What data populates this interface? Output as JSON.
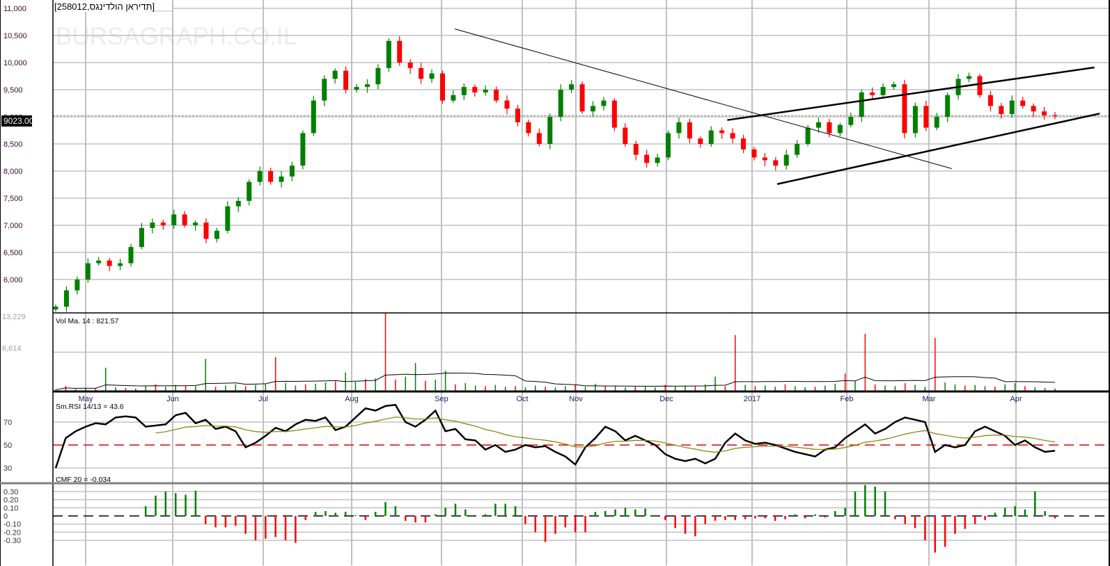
{
  "header": {
    "title": "[258012,תדיראן הולדינגס]",
    "watermark": "BURSAGRAPH.CO.IL",
    "last_price_label": "9023.00"
  },
  "colors": {
    "up": "#008000",
    "down": "#ff0000",
    "grid": "#c0c0c0",
    "signal": "#808000",
    "rsi_mid": "#e00000"
  },
  "chart_data": [
    {
      "type": "candlestick",
      "name": "price",
      "yticks": [
        "11,000",
        "10,500",
        "10,000",
        "9,500",
        "9,000",
        "8,500",
        "8,000",
        "7,500",
        "7,000",
        "6,500",
        "6,000"
      ],
      "ytick_values": [
        11000,
        10500,
        10000,
        9500,
        9000,
        8500,
        8000,
        7500,
        7000,
        6500,
        6000
      ],
      "ylim": [
        5300,
        11150
      ],
      "last_price": 9023,
      "x_months": [
        "May",
        "Jun",
        "Jul",
        "Aug",
        "Sep",
        "Oct",
        "Nov",
        "Dec",
        "2017",
        "Feb",
        "Mar",
        "Apr"
      ],
      "first_open": 5450,
      "close": [
        5500,
        5800,
        6000,
        6300,
        6350,
        6250,
        6300,
        6600,
        6950,
        7050,
        7000,
        7200,
        7000,
        7050,
        6750,
        6900,
        7350,
        7450,
        7800,
        8000,
        7800,
        7900,
        8100,
        8700,
        9300,
        9700,
        9850,
        9500,
        9550,
        9600,
        9900,
        10400,
        10000,
        9900,
        9700,
        9800,
        9300,
        9400,
        9550,
        9450,
        9500,
        9300,
        9150,
        8900,
        8700,
        8500,
        9000,
        9500,
        9600,
        9100,
        9200,
        9300,
        8800,
        8500,
        8300,
        8150,
        8250,
        8700,
        8900,
        8600,
        8500,
        8750,
        8700,
        8600,
        8400,
        8250,
        8200,
        8100,
        8300,
        8500,
        8800,
        8900,
        8700,
        8850,
        9000,
        9450,
        9400,
        9550,
        9600,
        8700,
        9200,
        8800,
        9000,
        9400,
        9700,
        9750,
        9400,
        9200,
        9050,
        9300,
        9200,
        9100,
        9030,
        9023
      ],
      "trendlines": [
        {
          "name": "downtrend",
          "from": [
            0.375,
            10620
          ],
          "to": [
            0.842,
            8045
          ]
        },
        {
          "name": "channel-upper",
          "from": [
            0.631,
            8940
          ],
          "to": [
            0.976,
            9910
          ]
        },
        {
          "name": "channel-lower",
          "from": [
            0.678,
            7760
          ],
          "to": [
            0.981,
            9060
          ]
        }
      ]
    },
    {
      "type": "bar",
      "name": "volume",
      "label": "Vol Ma. 14 : 821.57",
      "yticks": [
        "13,229",
        "6,614"
      ],
      "ytick_values": [
        13229,
        6614
      ],
      "ylim": [
        0,
        13229
      ],
      "ma_period": 14,
      "values": [
        300,
        900,
        400,
        600,
        500,
        4000,
        700,
        600,
        500,
        900,
        1200,
        800,
        1100,
        1000,
        900,
        5500,
        800,
        1000,
        1200,
        900,
        1100,
        1300,
        5800,
        1400,
        1000,
        1200,
        1300,
        1500,
        1700,
        3200,
        1600,
        2100,
        2200,
        13229,
        2000,
        2500,
        4800,
        1800,
        2000,
        3500,
        1200,
        1400,
        1000,
        900,
        1100,
        800,
        900,
        700,
        1000,
        800,
        700,
        900,
        1100,
        800,
        1300,
        900,
        1000,
        700,
        800,
        900,
        700,
        1100,
        800,
        1000,
        900,
        1200,
        2500,
        900,
        9500,
        1100,
        900,
        1000,
        800,
        1200,
        900,
        700,
        800,
        1000,
        1300,
        3000,
        1800,
        9700,
        1200,
        1000,
        900,
        1400,
        1100,
        800,
        9000,
        1500,
        1200,
        1000,
        1100,
        900,
        800,
        1200,
        1400,
        900,
        700,
        600,
        500
      ]
    },
    {
      "type": "line",
      "name": "rsi",
      "label": "Sm.RSI 14/13 = 43.6",
      "yticks": [
        "70",
        "50",
        "30"
      ],
      "ytick_values": [
        70,
        50,
        30
      ],
      "ylim": [
        20,
        90
      ],
      "values": [
        30,
        56,
        62,
        66,
        69,
        68,
        74,
        75,
        74,
        66,
        67,
        68,
        76,
        78,
        69,
        72,
        64,
        66,
        62,
        48,
        52,
        58,
        65,
        62,
        68,
        72,
        71,
        74,
        63,
        66,
        74,
        82,
        80,
        84,
        85,
        70,
        66,
        72,
        80,
        62,
        64,
        55,
        54,
        46,
        50,
        44,
        46,
        50,
        48,
        49,
        44,
        40,
        33,
        48,
        56,
        66,
        62,
        54,
        58,
        54,
        50,
        42,
        38,
        36,
        38,
        34,
        38,
        52,
        60,
        54,
        51,
        52,
        50,
        47,
        44,
        42,
        40,
        46,
        48,
        56,
        62,
        68,
        60,
        64,
        70,
        74,
        72,
        70,
        44,
        50,
        48,
        50,
        62,
        66,
        62,
        58,
        50,
        54,
        48,
        44,
        45
      ]
    },
    {
      "type": "bar",
      "name": "cmf",
      "label": "CMF 20 = -0.034",
      "yticks": [
        "0.30",
        "0.20",
        "0.10",
        "0",
        "-0.10",
        "-0.20",
        "-0.30"
      ],
      "ytick_values": [
        0.3,
        0.2,
        0.1,
        0,
        -0.1,
        -0.2,
        -0.3
      ],
      "ylim": [
        -0.55,
        0.45
      ],
      "values": [
        null,
        null,
        null,
        null,
        null,
        null,
        null,
        null,
        null,
        0.12,
        0.25,
        0.3,
        0.28,
        0.26,
        0.31,
        -0.1,
        -0.14,
        -0.14,
        -0.12,
        -0.22,
        -0.3,
        -0.28,
        -0.26,
        -0.3,
        -0.33,
        -0.05,
        0.05,
        0.06,
        0.04,
        0.05,
        0.01,
        -0.05,
        0.05,
        0.17,
        0.12,
        -0.06,
        -0.08,
        -0.08,
        0.02,
        0.1,
        0.15,
        0.08,
        0.01,
        0.02,
        0.15,
        0.15,
        0.12,
        -0.1,
        -0.2,
        -0.32,
        -0.22,
        -0.14,
        -0.2,
        -0.2,
        0.05,
        0.06,
        0.08,
        0.1,
        0.08,
        0.09,
        0.01,
        -0.05,
        -0.15,
        -0.22,
        -0.25,
        -0.1,
        -0.06,
        -0.05,
        -0.05,
        -0.04,
        -0.03,
        -0.03,
        -0.06,
        -0.04,
        0.02,
        -0.03,
        0.02,
        -0.02,
        0.06,
        0.1,
        0.3,
        0.38,
        0.36,
        0.3,
        -0.04,
        -0.1,
        -0.15,
        -0.3,
        -0.45,
        -0.38,
        -0.22,
        -0.16,
        -0.1,
        -0.05,
        0.04,
        0.1,
        0.12,
        0.08,
        0.3,
        0.06,
        -0.03
      ]
    }
  ]
}
